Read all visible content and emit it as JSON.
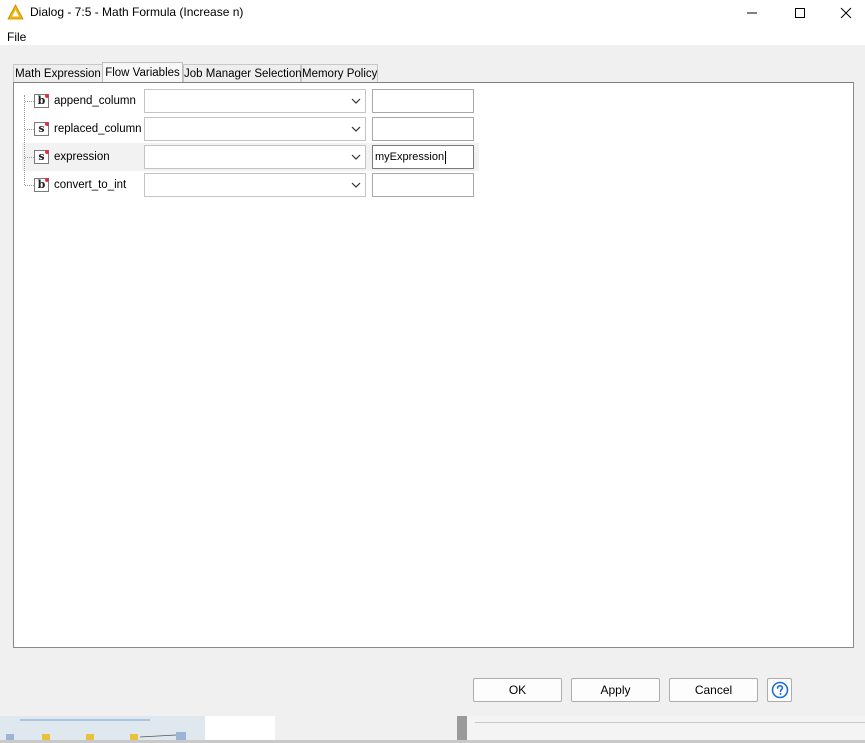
{
  "window": {
    "title": "Dialog - 7:5 - Math Formula (Increase n)",
    "title_icon": "warning-triangle-icon",
    "controls": [
      "minimize-icon",
      "maximize-icon",
      "close-icon"
    ]
  },
  "menu": {
    "file": "File"
  },
  "tabs": [
    {
      "label": "Math Expression",
      "active": false
    },
    {
      "label": "Flow Variables",
      "active": true
    },
    {
      "label": "Job Manager Selection",
      "active": false
    },
    {
      "label": "Memory Policy",
      "active": false
    }
  ],
  "variables": [
    {
      "type": "b",
      "name": "append_column",
      "selected": "",
      "value": ""
    },
    {
      "type": "s",
      "name": "replaced_column",
      "selected": "",
      "value": ""
    },
    {
      "type": "s",
      "name": "expression",
      "selected": "",
      "value": "myExpression"
    },
    {
      "type": "b",
      "name": "convert_to_int",
      "selected": "",
      "value": ""
    }
  ],
  "buttons": {
    "ok": "OK",
    "apply": "Apply",
    "cancel": "Cancel",
    "help_icon": "help-circle-icon"
  },
  "colors": {
    "accent": "#1e6fd0",
    "warning": "#f2b600",
    "type_dot": "#e0303a"
  }
}
